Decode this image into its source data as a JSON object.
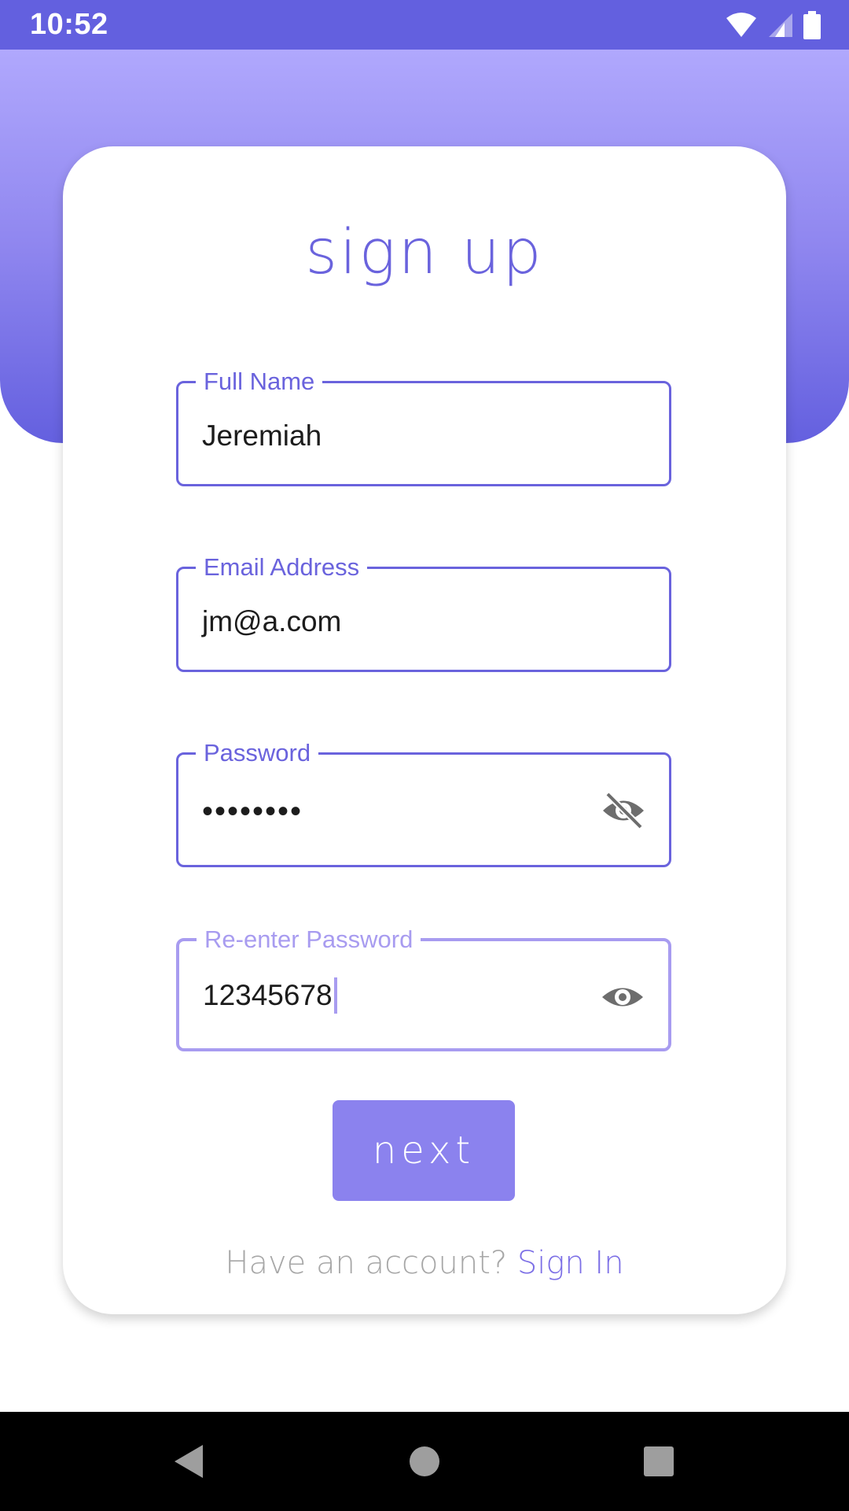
{
  "status_bar": {
    "time": "10:52",
    "icons": [
      "wifi-icon",
      "signal-icon",
      "battery-icon"
    ],
    "color": "#6360df"
  },
  "form": {
    "title": "sign up",
    "fields": [
      {
        "label": "Full Name",
        "value": "Jeremiah",
        "type": "text"
      },
      {
        "label": "Email Address",
        "value": "jm@a.com",
        "type": "email"
      },
      {
        "label": "Password",
        "value": "••••••••",
        "type": "password",
        "icon": "eye-off-icon"
      },
      {
        "label": "Re-enter Password",
        "value": "12345678",
        "type": "text",
        "focused": true,
        "icon": "eye-icon"
      }
    ],
    "next_label": "next",
    "footer_text": "Have an account?",
    "footer_link": "Sign In"
  },
  "nav_bar": {
    "buttons": [
      "back-icon",
      "home-icon",
      "recents-icon"
    ]
  },
  "colors": {
    "accent": "#6a63dd",
    "button": "#8b82ee",
    "focused_border": "#a89cf0"
  }
}
